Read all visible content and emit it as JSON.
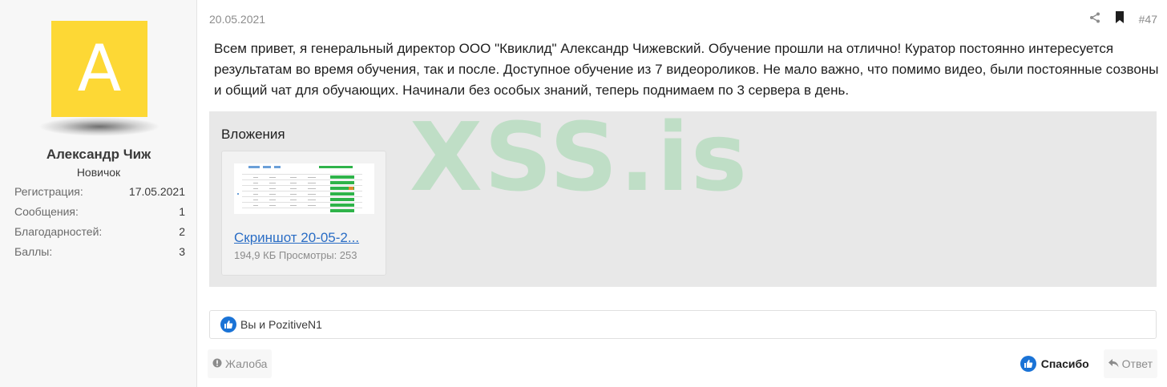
{
  "user": {
    "avatar_letter": "A",
    "avatar_color": "#fdd835",
    "name": "Александр Чиж",
    "title": "Новичок",
    "stats": [
      {
        "label": "Регистрация:",
        "value": "17.05.2021"
      },
      {
        "label": "Сообщения:",
        "value": "1"
      },
      {
        "label": "Благодарностей:",
        "value": "2"
      },
      {
        "label": "Баллы:",
        "value": "3"
      }
    ]
  },
  "post": {
    "date": "20.05.2021",
    "number": "#47",
    "body": "Всем привет, я генеральный директор ООО \"Квиклид\" Александр Чижевский. Обучение прошли на отлично! Куратор постоянно интересуется результатам во время обучения, так и после. Доступное обучение из 7 видеороликов. Не мало важно, что помимо видео, были постоянные созвоны и общий чат для обучающих. Начинали без особых знаний, теперь поднимаем по 3 сервера в день."
  },
  "attachments": {
    "heading": "Вложения",
    "watermark": "XSS.is",
    "items": [
      {
        "name": "Скриншот 20-05-2...",
        "meta": "194,9 КБ Просмотры: 253"
      }
    ]
  },
  "reactions": {
    "text": "Вы и PozitiveN1",
    "icon": "like-icon"
  },
  "footer": {
    "report_label": "Жалоба",
    "thanks_label": "Спасибо",
    "reply_label": "Ответ"
  },
  "colors": {
    "accent": "#1a73d6",
    "link": "#2a6dc5",
    "watermark": "#60c878"
  }
}
